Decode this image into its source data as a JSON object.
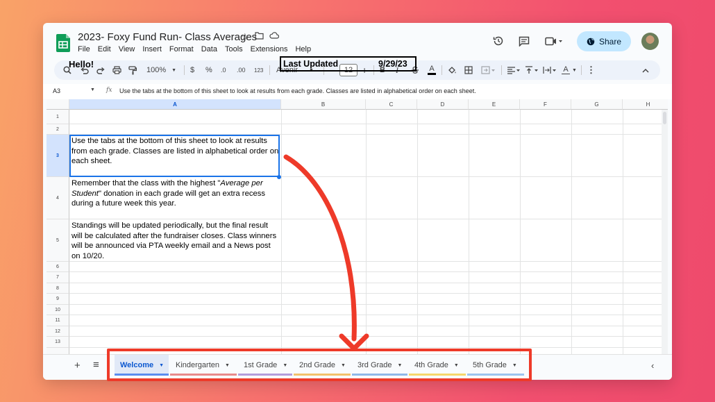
{
  "window": {
    "doc_title": "2023- Foxy Fund Run- Class Averages",
    "menu": [
      "File",
      "Edit",
      "View",
      "Insert",
      "Format",
      "Data",
      "Tools",
      "Extensions",
      "Help"
    ],
    "share_label": "Share"
  },
  "toolbar": {
    "zoom": "100%",
    "currency": "$",
    "percent": "%",
    "decimal_decrease": ".0",
    "decimal_increase": ".00",
    "format_number": "123",
    "font": "Avenir",
    "font_size": "12",
    "bold": "B",
    "italic": "I",
    "text_color_label": "A",
    "text_color_label_2": "A"
  },
  "formula_bar": {
    "cell_ref": "A3",
    "fx": "fx",
    "content": "Use the tabs at the bottom of this sheet to look at results from each grade. Classes are listed in alphabetical order on each sheet."
  },
  "grid": {
    "columns": [
      "A",
      "B",
      "C",
      "D",
      "E",
      "F",
      "G",
      "H"
    ],
    "rows": [
      "1",
      "2",
      "3",
      "4",
      "5",
      "6",
      "7",
      "8",
      "9",
      "10",
      "11",
      "12",
      "13"
    ],
    "selected_column": "A",
    "selected_row": "3",
    "cells": {
      "A1": "Hello!",
      "B1": "Last Updated",
      "C1": "9/29/23",
      "A3": "Use the tabs at the bottom of this sheet to look at results from each grade. Classes are listed in alphabetical order on each sheet.",
      "A4_part1": "Remember that the class with the highest \"",
      "A4_italic": "Average per Student",
      "A4_part2": "\" donation in each grade will get an extra recess during a future week this year.",
      "A5": "Standings will be updated periodically, but the final result will be calculated after the fundraiser closes. Class winners will be announced via PTA weekly email and a News post on 10/20."
    }
  },
  "tabs": {
    "add": "+",
    "list": "≡",
    "items": [
      {
        "label": "Welcome",
        "color": "#5b8def",
        "active": true
      },
      {
        "label": "Kindergarten",
        "color": "#e88a8a",
        "active": false
      },
      {
        "label": "1st Grade",
        "color": "#b39ddb",
        "active": false
      },
      {
        "label": "2nd Grade",
        "color": "#f2c16b",
        "active": false
      },
      {
        "label": "3rd Grade",
        "color": "#8fb8e8",
        "active": false
      },
      {
        "label": "4th Grade",
        "color": "#f5d66b",
        "active": false
      },
      {
        "label": "5th Grade",
        "color": "#9cc4ef",
        "active": false
      }
    ]
  },
  "colors": {
    "accent": "#0b57d0",
    "share_bg": "#c2e7ff",
    "annotation": "#ee3a29"
  }
}
